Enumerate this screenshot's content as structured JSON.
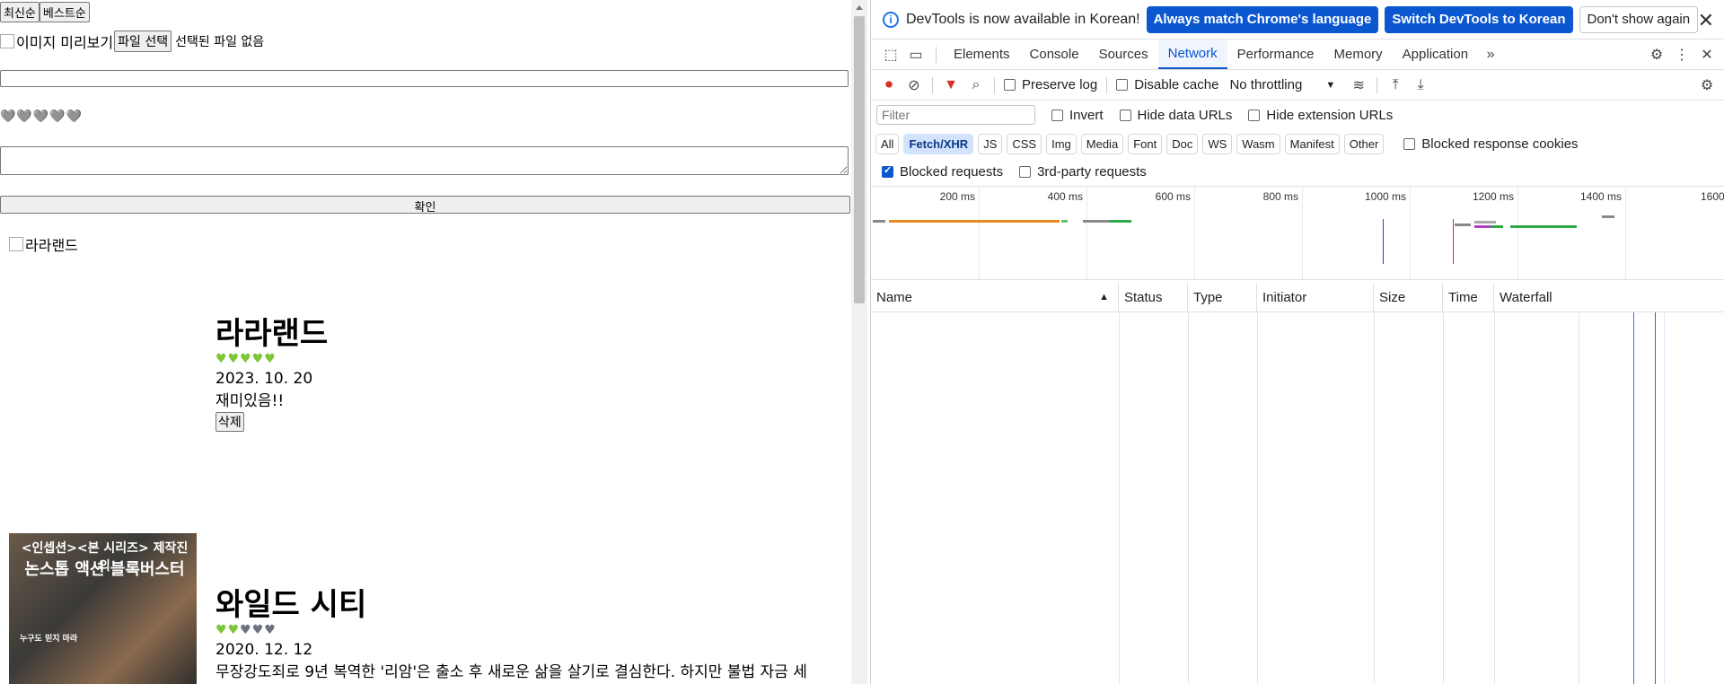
{
  "page": {
    "sort_latest": "최신순",
    "sort_best": "베스트순",
    "image_preview_alt": "이미지 미리보기",
    "file_button": "파일 선택",
    "file_status": "선택된 파일 없음",
    "rating_hearts": "🩶🩶🩶🩶🩶",
    "confirm_label": "확인",
    "cards": [
      {
        "poster_alt": "라라랜드",
        "title": "라라랜드",
        "rating": 5,
        "date": "2023. 10. 20",
        "review": "재미있음!!",
        "delete_label": "삭제"
      },
      {
        "poster_line1": "<인셉션><본 시리즈> 제작진의",
        "poster_line2": "논스톱 액션 블록버스터",
        "poster_line3": "누구도 믿지 마라",
        "title": "와일드 시티",
        "rating": 2,
        "date": "2020. 12. 12",
        "review": "무장강도죄로 9년 복역한 '리암'은 출소 후 새로운 삶을 살기로 결심한다. 하지만 불법 자금 세"
      }
    ]
  },
  "devtools": {
    "info_text": "DevTools is now available in Korean!",
    "btn_match": "Always match Chrome's language",
    "btn_switch": "Switch DevTools to Korean",
    "btn_dismiss": "Don't show again",
    "tabs": [
      "Elements",
      "Console",
      "Sources",
      "Network",
      "Performance",
      "Memory",
      "Application"
    ],
    "active_tab": "Network",
    "preserve_log": "Preserve log",
    "disable_cache": "Disable cache",
    "throttling": "No throttling",
    "filter_placeholder": "Filter",
    "invert": "Invert",
    "hide_data_urls": "Hide data URLs",
    "hide_extension_urls": "Hide extension URLs",
    "type_filters": [
      "All",
      "Fetch/XHR",
      "JS",
      "CSS",
      "Img",
      "Media",
      "Font",
      "Doc",
      "WS",
      "Wasm",
      "Manifest",
      "Other"
    ],
    "active_type": "Fetch/XHR",
    "blocked_response_cookies": "Blocked response cookies",
    "blocked_requests": "Blocked requests",
    "third_party": "3rd-party requests",
    "timeline_ticks": [
      "200 ms",
      "400 ms",
      "600 ms",
      "800 ms",
      "1000 ms",
      "1200 ms",
      "1400 ms",
      "1600"
    ],
    "columns": [
      "Name",
      "Status",
      "Type",
      "Initiator",
      "Size",
      "Time",
      "Waterfall"
    ]
  }
}
